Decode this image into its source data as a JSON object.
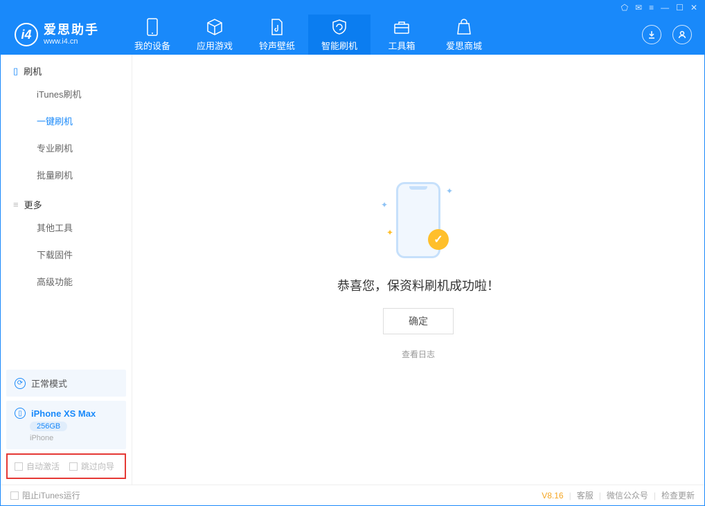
{
  "app": {
    "name": "爱思助手",
    "site": "www.i4.cn"
  },
  "nav": {
    "tabs": [
      {
        "label": "我的设备"
      },
      {
        "label": "应用游戏"
      },
      {
        "label": "铃声壁纸"
      },
      {
        "label": "智能刷机"
      },
      {
        "label": "工具箱"
      },
      {
        "label": "爱思商城"
      }
    ]
  },
  "sidebar": {
    "group_flash": "刷机",
    "items_flash": [
      {
        "label": "iTunes刷机"
      },
      {
        "label": "一键刷机"
      },
      {
        "label": "专业刷机"
      },
      {
        "label": "批量刷机"
      }
    ],
    "group_more": "更多",
    "items_more": [
      {
        "label": "其他工具"
      },
      {
        "label": "下载固件"
      },
      {
        "label": "高级功能"
      }
    ],
    "mode": "正常模式",
    "device": {
      "name": "iPhone XS Max",
      "capacity": "256GB",
      "type": "iPhone"
    },
    "checkbox_auto_activate": "自动激活",
    "checkbox_skip_guide": "跳过向导"
  },
  "main": {
    "success_text": "恭喜您，保资料刷机成功啦！",
    "ok_button": "确定",
    "view_log": "查看日志"
  },
  "footer": {
    "block_itunes": "阻止iTunes运行",
    "version": "V8.16",
    "links": [
      {
        "label": "客服"
      },
      {
        "label": "微信公众号"
      },
      {
        "label": "检查更新"
      }
    ]
  }
}
